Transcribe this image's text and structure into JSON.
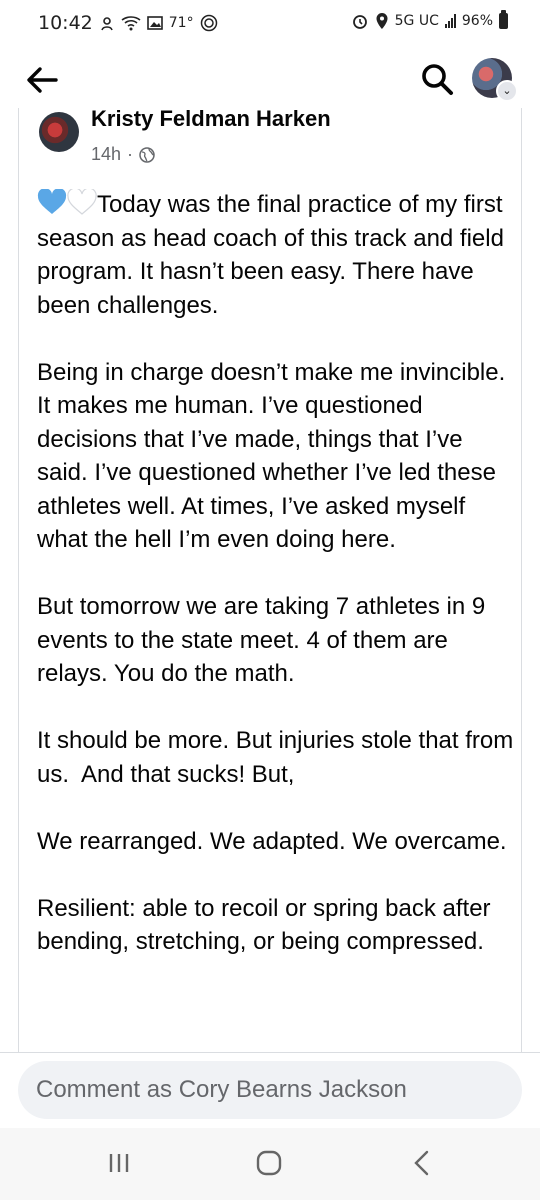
{
  "status_bar": {
    "time": "10:42",
    "temperature": "71°",
    "network": "5G UC",
    "battery": "96%"
  },
  "post": {
    "author": "Kristy Feldman Harken",
    "time": "14h",
    "separator": "·",
    "paragraphs": [
      "Today was the final practice of my first season as head coach of this track and field program. It hasn’t been easy. There have been challenges.",
      "Being in charge doesn’t make me invincible. It makes me human. I’ve questioned decisions that I’ve made, things that I’ve said. I’ve questioned whether I’ve led these athletes well. At times, I’ve asked myself what the hell I’m even doing here.",
      "But tomorrow we are taking 7 athletes in 9 events to the state meet. 4 of them are relays. You do the math.",
      "It should be more. But injuries stole that from us.  And that sucks! But,",
      "We rearranged. We adapted. We overcame.",
      "Resilient: able to recoil or spring back after bending, stretching, or being compressed."
    ]
  },
  "comment": {
    "placeholder": "Comment as Cory Bearns Jackson"
  },
  "colors": {
    "heart_blue": "#5aa7e6",
    "meta_gray": "#65676b"
  }
}
